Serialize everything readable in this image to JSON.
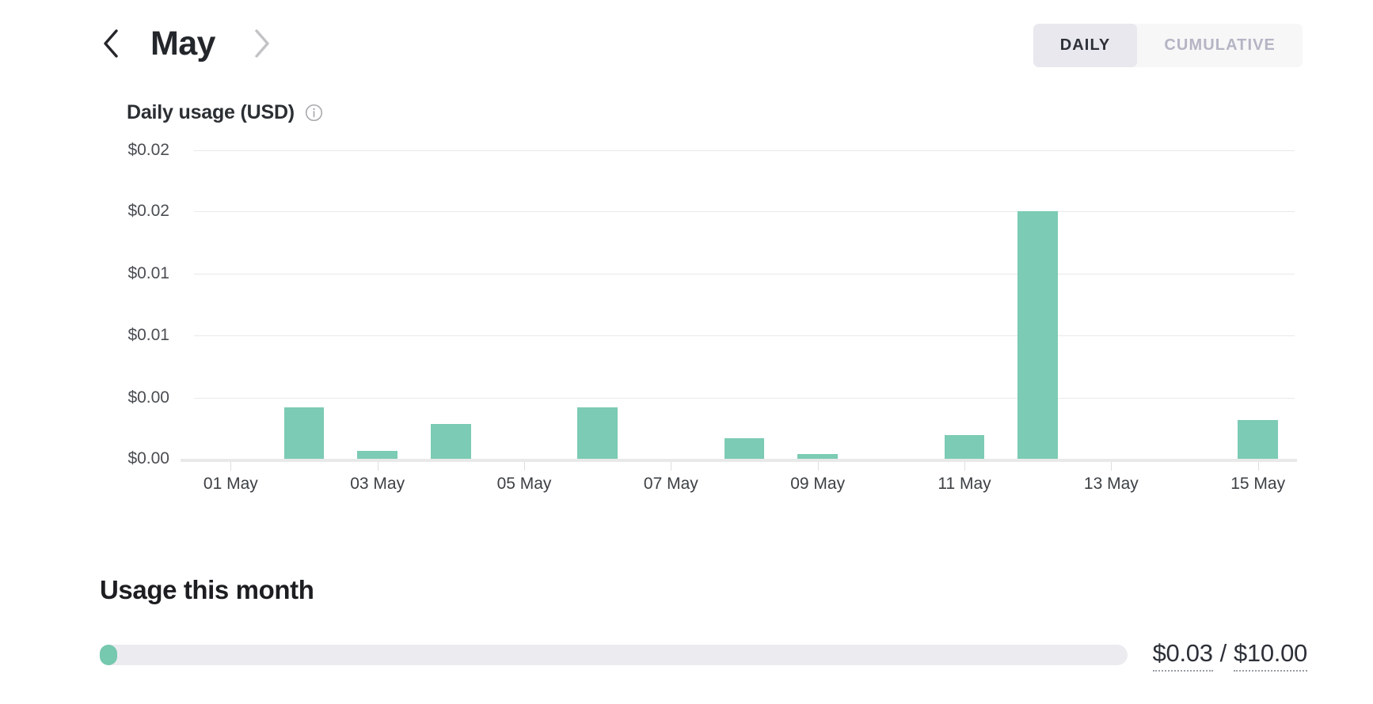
{
  "header": {
    "month": "May",
    "prev_icon": "chevron-left-icon",
    "next_icon": "chevron-right-icon",
    "toggle": {
      "daily_label": "DAILY",
      "cumulative_label": "CUMULATIVE",
      "selected": "DAILY"
    }
  },
  "chart_section": {
    "title": "Daily usage (USD)",
    "info_icon": "info-circle-icon"
  },
  "usage": {
    "heading": "Usage this month",
    "current": "$0.03",
    "separator": "/",
    "limit": "$10.00",
    "percent": 0.3
  },
  "colors": {
    "bar": "#7ccbb4",
    "progress_fill": "#76c8af",
    "progress_track": "#ecebf0",
    "grid": "#e9e9ea",
    "text_primary": "#23262a",
    "text_muted": "#b4b4c4"
  },
  "chart_data": {
    "type": "bar",
    "title": "Daily usage (USD)",
    "xlabel": "",
    "ylabel": "",
    "grid": true,
    "legend": null,
    "ylim": [
      0,
      0.0197
    ],
    "ytick_values": [
      0.0197,
      0.0158,
      0.0118,
      0.0079,
      0.0039,
      0
    ],
    "ytick_labels": [
      "$0.02",
      "$0.02",
      "$0.01",
      "$0.01",
      "$0.00",
      "$0.00"
    ],
    "categories": [
      "01 May",
      "02 May",
      "03 May",
      "04 May",
      "05 May",
      "06 May",
      "07 May",
      "08 May",
      "09 May",
      "10 May",
      "11 May",
      "12 May",
      "13 May",
      "14 May",
      "15 May"
    ],
    "xtick_labels": [
      "01 May",
      "03 May",
      "05 May",
      "07 May",
      "09 May",
      "11 May",
      "13 May",
      "15 May"
    ],
    "values": [
      0,
      0.0033,
      0.0005,
      0.0022,
      0,
      0.0033,
      0,
      0.0013,
      0.0003,
      0,
      0.0015,
      0.0158,
      0,
      0,
      0.0025
    ]
  }
}
